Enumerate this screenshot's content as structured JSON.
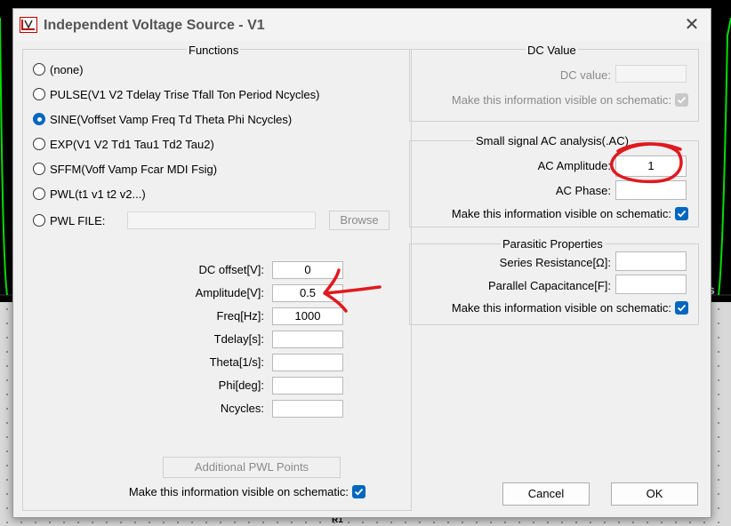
{
  "dialog": {
    "title": "Independent Voltage Source - V1",
    "close_glyph": "✕"
  },
  "functions": {
    "title": "Functions",
    "options": [
      {
        "label": "(none)",
        "selected": false
      },
      {
        "label": "PULSE(V1 V2 Tdelay Trise Tfall Ton Period Ncycles)",
        "selected": false
      },
      {
        "label": "SINE(Voffset Vamp Freq Td Theta Phi Ncycles)",
        "selected": true
      },
      {
        "label": "EXP(V1 V2 Td1 Tau1 Td2 Tau2)",
        "selected": false
      },
      {
        "label": "SFFM(Voff Vamp Fcar MDI Fsig)",
        "selected": false
      },
      {
        "label": "PWL(t1 v1 t2 v2...)",
        "selected": false
      },
      {
        "label": "PWL FILE:",
        "selected": false
      }
    ],
    "pwl_file_value": "",
    "browse_label": "Browse",
    "params": [
      {
        "label": "DC offset[V]:",
        "value": "0"
      },
      {
        "label": "Amplitude[V]:",
        "value": "0.5"
      },
      {
        "label": "Freq[Hz]:",
        "value": "1000"
      },
      {
        "label": "Tdelay[s]:",
        "value": ""
      },
      {
        "label": "Theta[1/s]:",
        "value": ""
      },
      {
        "label": "Phi[deg]:",
        "value": ""
      },
      {
        "label": "Ncycles:",
        "value": ""
      }
    ],
    "additional_pwl_label": "Additional PWL Points",
    "visible_label": "Make this information visible on schematic:",
    "visible_checked": true
  },
  "dc_value": {
    "title": "DC Value",
    "label": "DC value:",
    "value": "",
    "visible_label": "Make this information visible on schematic:",
    "visible_checked": true,
    "disabled": true
  },
  "ac_analysis": {
    "title": "Small signal AC analysis(.AC)",
    "amplitude_label": "AC Amplitude:",
    "amplitude_value": "1",
    "phase_label": "AC Phase:",
    "phase_value": "",
    "visible_label": "Make this information visible on schematic:",
    "visible_checked": true
  },
  "parasitic": {
    "title": "Parasitic Properties",
    "series_label": "Series Resistance[Ω]:",
    "series_value": "",
    "parallel_label": "Parallel Capacitance[F]:",
    "parallel_value": "",
    "visible_label": "Make this information visible on schematic:",
    "visible_checked": true
  },
  "buttons": {
    "cancel": "Cancel",
    "ok": "OK"
  },
  "background": {
    "component_label": "R1",
    "fragment_text": "s",
    "wave_color": "#00e000"
  },
  "colors": {
    "accent": "#0067c0",
    "annotation": "#e0191f"
  }
}
